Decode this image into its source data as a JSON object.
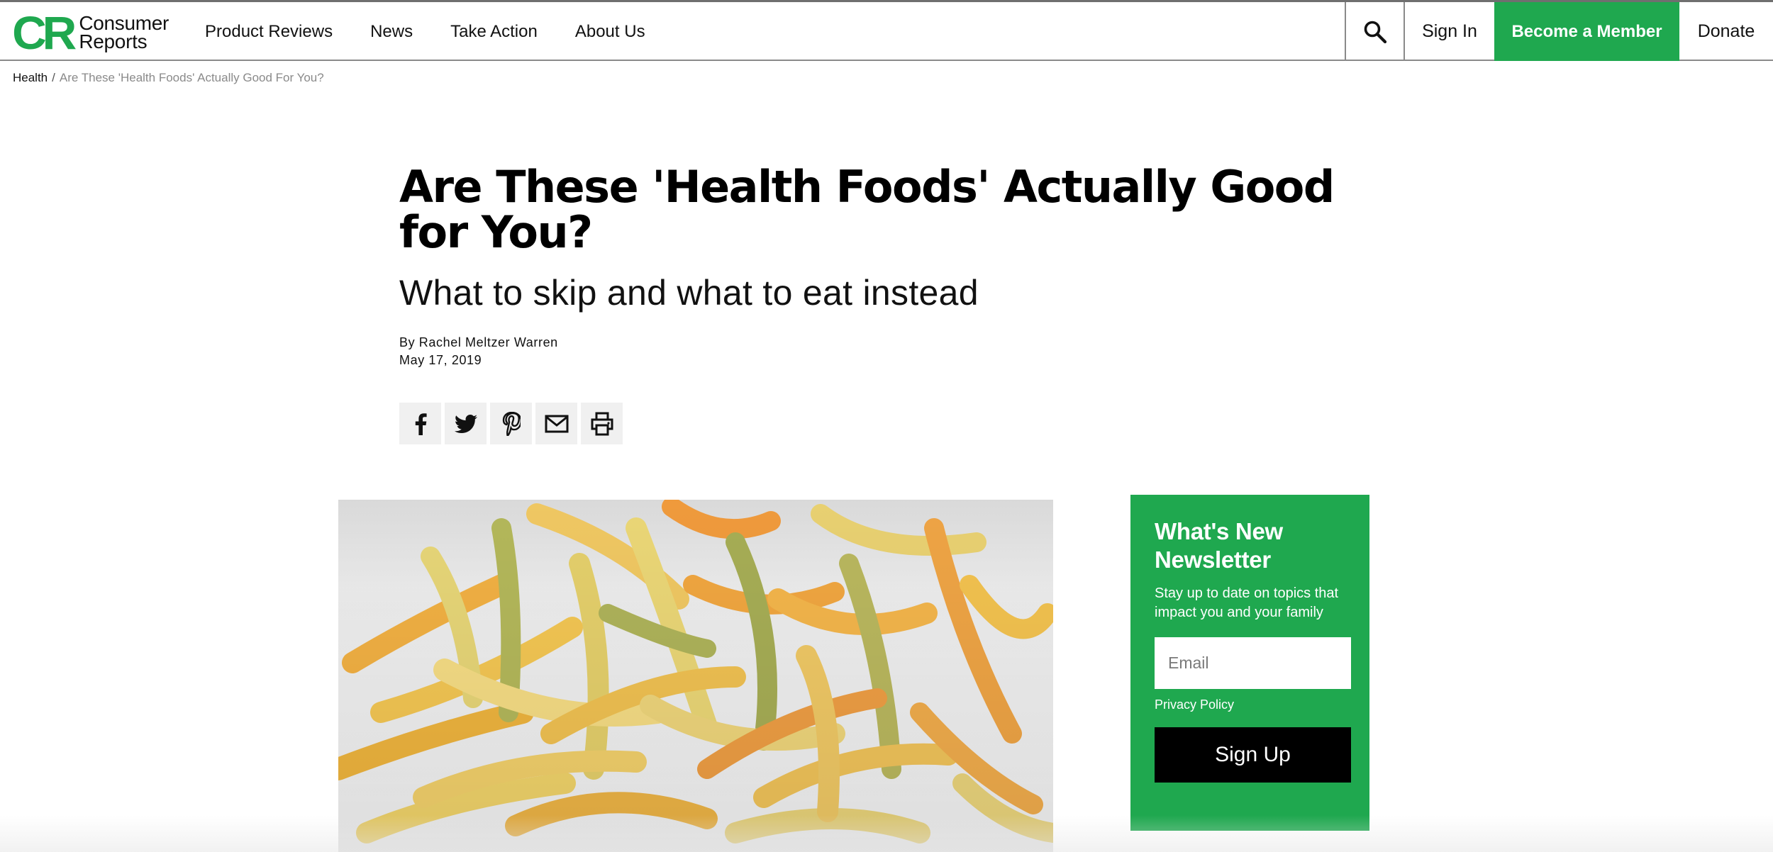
{
  "brand": {
    "mark": "CR",
    "word1": "Consumer",
    "word2": "Reports",
    "color": "#1fa84f"
  },
  "nav": {
    "items": [
      {
        "label": "Product Reviews"
      },
      {
        "label": "News"
      },
      {
        "label": "Take Action"
      },
      {
        "label": "About Us"
      }
    ],
    "search_icon": "search-icon",
    "sign_in": "Sign In",
    "become_member": "Become a Member",
    "donate": "Donate"
  },
  "breadcrumb": {
    "parent": "Health",
    "separator": "/",
    "current": "Are These 'Health Foods' Actually Good For You?"
  },
  "article": {
    "title": "Are These 'Health Foods' Actually Good for You?",
    "subtitle": "What to skip and what to eat instead",
    "author": "By Rachel Meltzer Warren",
    "date": "May 17, 2019",
    "share_icons": [
      "facebook-icon",
      "twitter-icon",
      "pinterest-icon",
      "email-icon",
      "print-icon"
    ]
  },
  "newsletter": {
    "title": "What's New Newsletter",
    "description": "Stay up to date on topics that impact you and your family",
    "email_placeholder": "Email",
    "privacy": "Privacy Policy",
    "signup": "Sign Up",
    "background": "#1fa84f"
  }
}
